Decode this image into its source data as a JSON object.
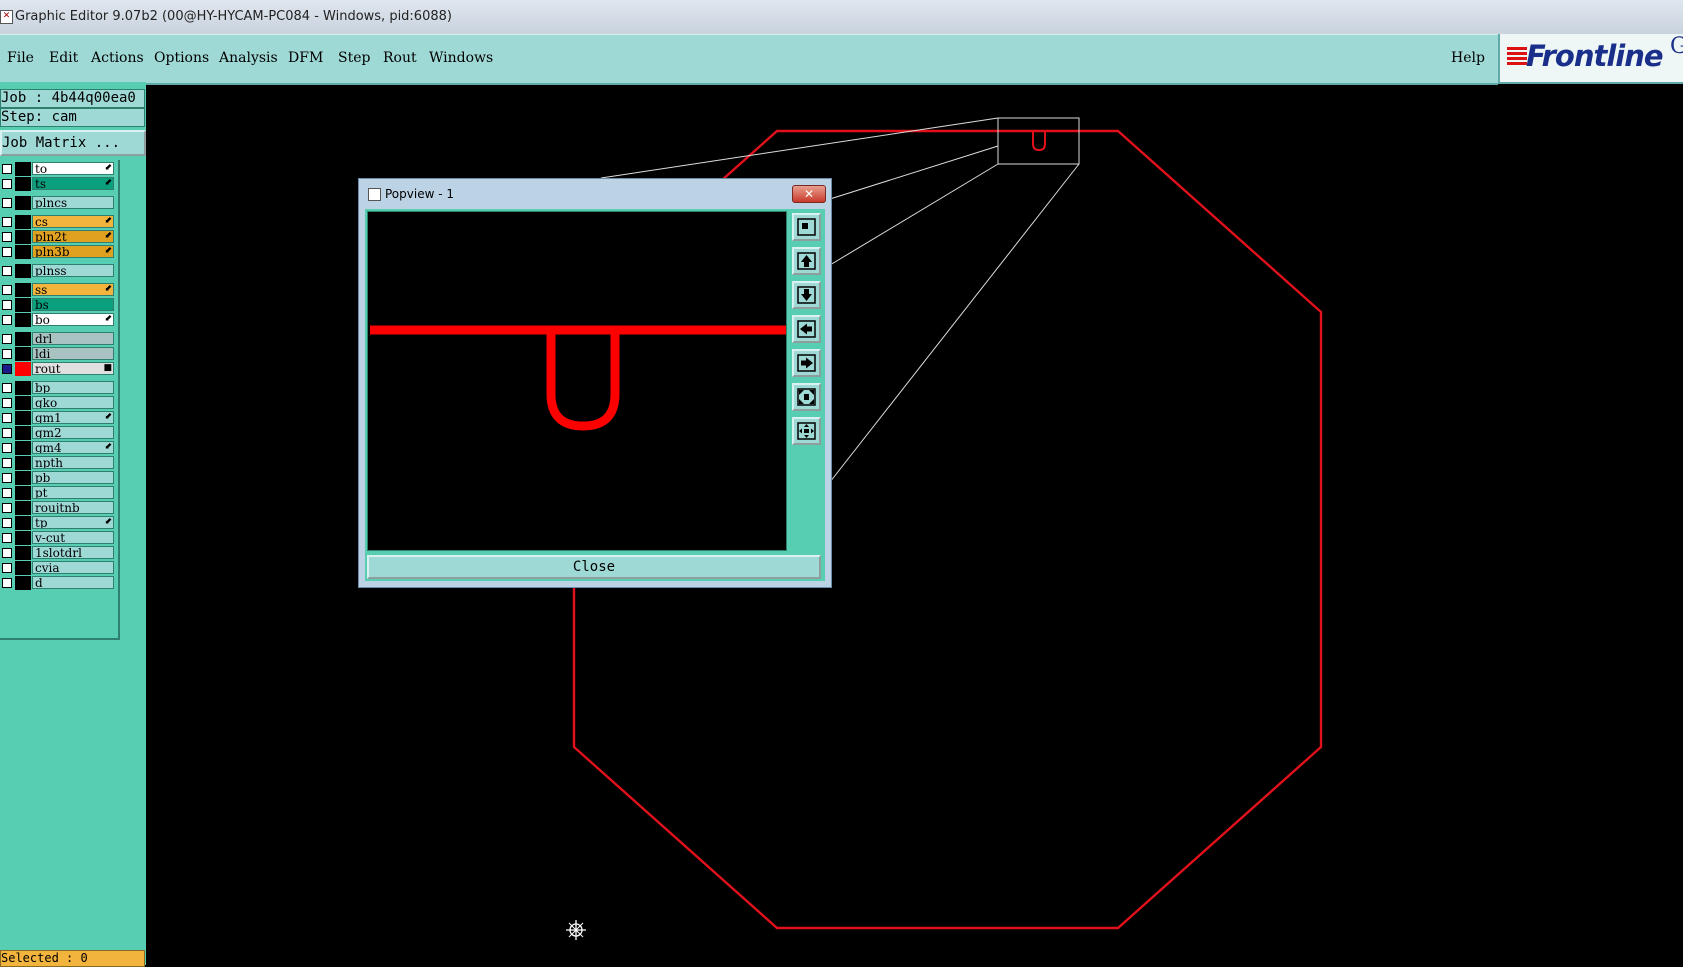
{
  "window": {
    "title": "Graphic Editor 9.07b2 (00@HY-HYCAM-PC084 - Windows, pid:6088)"
  },
  "menu": {
    "items": [
      "File",
      "Edit",
      "Actions",
      "Options",
      "Analysis",
      "DFM",
      "Step",
      "Rout",
      "Windows"
    ],
    "help": "Help"
  },
  "logo": {
    "text": "Frontline",
    "extra": "G"
  },
  "info": {
    "job": "Job : 4b44q00ea0",
    "step": "Step: cam",
    "job_matrix": "Job Matrix ..."
  },
  "layers": [
    {
      "name": "to",
      "color": "#ffffff",
      "mark": true
    },
    {
      "name": "ts",
      "color": "#0aa07e",
      "mark": true
    },
    {
      "name": "plncs",
      "color": "#9fd9d6",
      "mark": false
    },
    {
      "name": "cs",
      "color": "#f3b43d",
      "mark": true
    },
    {
      "name": "pln2t",
      "color": "#e0a020",
      "mark": true
    },
    {
      "name": "pln3b",
      "color": "#e0a020",
      "mark": true
    },
    {
      "name": "plnss",
      "color": "#9fd9d6",
      "mark": false
    },
    {
      "name": "ss",
      "color": "#f3b43d",
      "mark": true
    },
    {
      "name": "bs",
      "color": "#0aa07e",
      "mark": false
    },
    {
      "name": "bo",
      "color": "#ffffff",
      "mark": true
    },
    {
      "name": "drl",
      "color": "#a9c3c3",
      "mark": false
    },
    {
      "name": "ldi",
      "color": "#a9c3c3",
      "mark": false
    },
    {
      "name": "rout",
      "color": "#e0e0e0",
      "mark": true,
      "active": true
    },
    {
      "name": "bp",
      "color": "#9fd9d6",
      "mark": false
    },
    {
      "name": "gko",
      "color": "#9fd9d6",
      "mark": false
    },
    {
      "name": "gm1",
      "color": "#9fd9d6",
      "mark": true
    },
    {
      "name": "gm2",
      "color": "#9fd9d6",
      "mark": false
    },
    {
      "name": "gm4",
      "color": "#9fd9d6",
      "mark": true
    },
    {
      "name": "npth",
      "color": "#9fd9d6",
      "mark": false
    },
    {
      "name": "pb",
      "color": "#9fd9d6",
      "mark": false
    },
    {
      "name": "pt",
      "color": "#9fd9d6",
      "mark": false
    },
    {
      "name": "roujtnb",
      "color": "#9fd9d6",
      "mark": false
    },
    {
      "name": "tp",
      "color": "#9fd9d6",
      "mark": true
    },
    {
      "name": "v-cut",
      "color": "#9fd9d6",
      "mark": false
    },
    {
      "name": "1slotdrl",
      "color": "#9fd9d6",
      "mark": false
    },
    {
      "name": "cvia",
      "color": "#9fd9d6",
      "mark": false
    },
    {
      "name": "d",
      "color": "#9fd9d6",
      "mark": false
    }
  ],
  "status": {
    "selected": "Selected : 0"
  },
  "popview": {
    "title": "Popview - 1",
    "close_button": "Close",
    "close_icon": "✕",
    "tools": [
      "zoom-window-icon",
      "pan-up-icon",
      "pan-down-icon",
      "pan-left-icon",
      "pan-right-icon",
      "zoom-in-icon",
      "zoom-out-icon"
    ]
  },
  "colors": {
    "outline": "#e0111b",
    "panel": "#57cdb1",
    "menubar": "#9fd9d6"
  }
}
